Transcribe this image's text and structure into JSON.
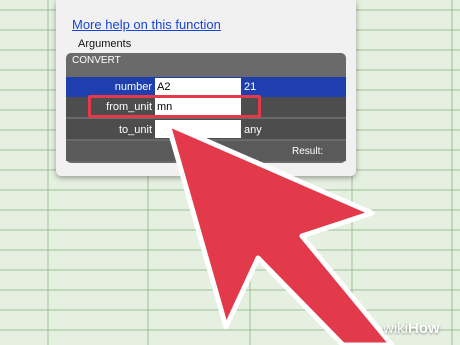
{
  "help_link": "More help on this function",
  "arguments_label": "Arguments",
  "function_name": "CONVERT",
  "args": [
    {
      "label": "number",
      "value": "A2",
      "preview": "21"
    },
    {
      "label": "from_unit",
      "value": "mn",
      "preview": ""
    },
    {
      "label": "to_unit",
      "value": "",
      "preview": "any"
    }
  ],
  "result_label": "Result:",
  "watermark": {
    "wiki": "wiki",
    "how": "How"
  },
  "colors": {
    "grid_bg": "#bfd8b4",
    "grid_line": "#9fbf93",
    "active_row": "#1f3fae",
    "highlight": "#e23a4a",
    "arrow": "#e23a4a"
  }
}
